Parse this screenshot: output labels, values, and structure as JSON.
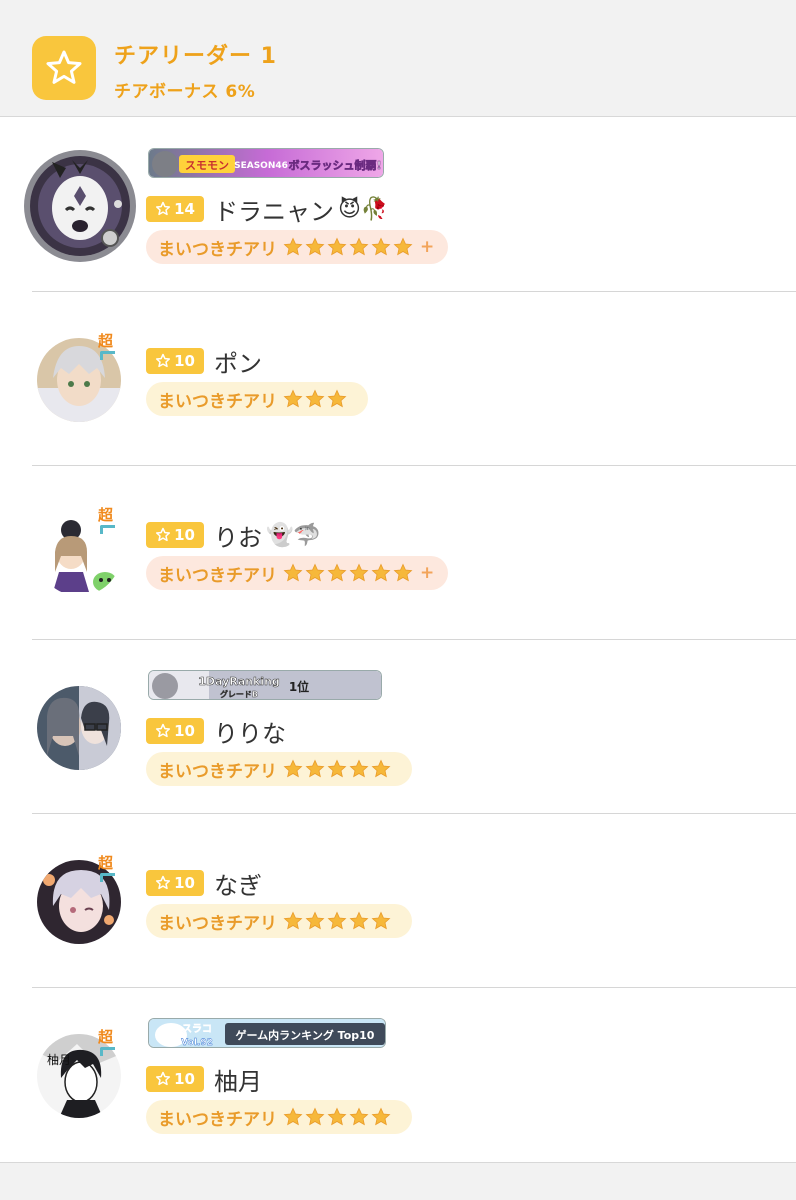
{
  "header": {
    "title": "チアリーダー 1",
    "subtitle": "チアボーナス 6%",
    "icon": "star-icon"
  },
  "colors": {
    "accent": "#f9c63d",
    "accent_text": "#eea21b",
    "cheer_warm_bg": "#fde8de",
    "cheer_gold_bg": "#fdf3d6"
  },
  "rows": [
    {
      "level": "14",
      "name": "ドラニャン",
      "name_emoji": "😈🥀",
      "banner": {
        "brand": "スモモン",
        "season": "SEASON46",
        "text": "ボスラッシュ制覇!"
      },
      "cheer_label": "まいつきチアリ",
      "cheer_stars": 6,
      "cheer_plus": "+"
    },
    {
      "level": "10",
      "name": "ポン",
      "name_emoji": "",
      "super_badge": "超",
      "cheer_label": "まいつきチアリ",
      "cheer_stars": 3,
      "cheer_plus": ""
    },
    {
      "level": "10",
      "name": "りお",
      "name_emoji": "👻🦈",
      "super_badge": "超",
      "cheer_label": "まいつきチアリ",
      "cheer_stars": 6,
      "cheer_plus": "+"
    },
    {
      "level": "10",
      "name": "りりな",
      "name_emoji": "",
      "banner": {
        "brand": "1DayRanking",
        "season": "グレードB",
        "text": "1位"
      },
      "cheer_label": "まいつきチアリ",
      "cheer_stars": 5,
      "cheer_plus": ""
    },
    {
      "level": "10",
      "name": "なぎ",
      "name_emoji": "",
      "super_badge": "超",
      "cheer_label": "まいつきチアリ",
      "cheer_stars": 5,
      "cheer_plus": ""
    },
    {
      "level": "10",
      "name": "柚月",
      "name_emoji": "",
      "super_badge": "超",
      "banner": {
        "brand": "スラコ",
        "season": "Vol.92",
        "text": "ゲーム内ランキング Top10"
      },
      "cheer_label": "まいつきチアリ",
      "cheer_stars": 5,
      "cheer_plus": ""
    }
  ]
}
